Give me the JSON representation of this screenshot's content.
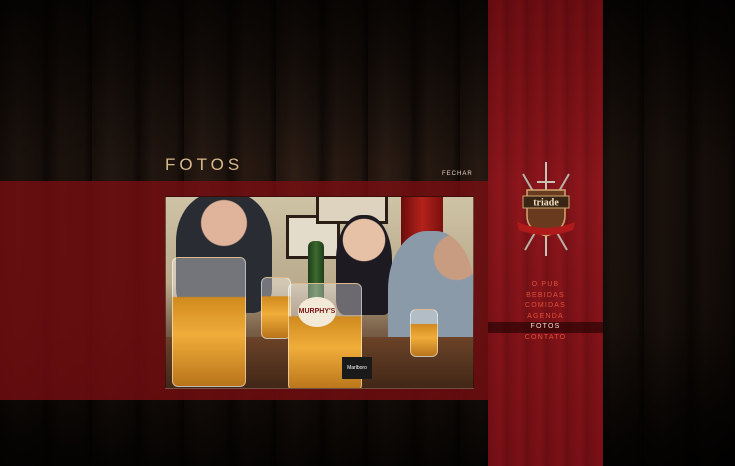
{
  "page": {
    "title": "FOTOS",
    "close_label": "FECHAR"
  },
  "photo": {
    "bottle_label": "MURPHY'S",
    "cigarette_label": "Marlboro"
  },
  "logo": {
    "text": "triade"
  },
  "menu": {
    "items": [
      {
        "label": "O PUB"
      },
      {
        "label": "BEBIDAS"
      },
      {
        "label": "COMIDAS"
      },
      {
        "label": "AGENDA"
      },
      {
        "label": "FOTOS"
      },
      {
        "label": "CONTATO"
      }
    ],
    "active": "FOTOS"
  },
  "colors": {
    "accent_red": "#8e161c",
    "menu_text": "#e0503a",
    "title_text": "#d9b98e"
  }
}
